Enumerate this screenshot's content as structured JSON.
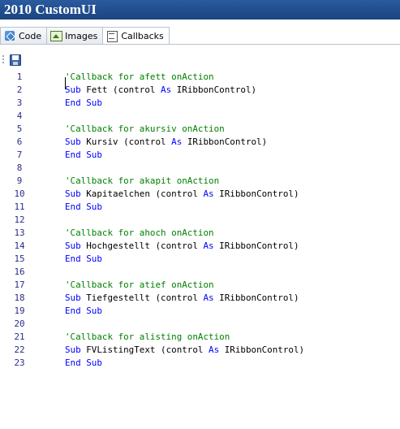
{
  "window": {
    "title": "2010 CustomUI"
  },
  "tabs": [
    {
      "label": "Code",
      "icon": "code-icon"
    },
    {
      "label": "Images",
      "icon": "images-icon"
    },
    {
      "label": "Callbacks",
      "icon": "callbacks-icon",
      "active": true
    }
  ],
  "toolbar": {
    "save_icon": "save-icon"
  },
  "colors": {
    "keyword": "#0000ff",
    "comment": "#008000",
    "line_number": "#2b2b8a",
    "title_bar": "#1f4c8c"
  },
  "editor": {
    "lines": [
      {
        "num": "1",
        "parts": [
          [
            "cm",
            "'Callback for afett onAction"
          ]
        ]
      },
      {
        "num": "2",
        "parts": [
          [
            "kw",
            "Sub"
          ],
          [
            "tx",
            " Fett (control "
          ],
          [
            "kw",
            "As"
          ],
          [
            "tx",
            " IRibbonControl)"
          ]
        ]
      },
      {
        "num": "3",
        "parts": [
          [
            "kw",
            "End Sub"
          ]
        ]
      },
      {
        "num": "4",
        "parts": []
      },
      {
        "num": "5",
        "parts": [
          [
            "cm",
            "'Callback for akursiv onAction"
          ]
        ]
      },
      {
        "num": "6",
        "parts": [
          [
            "kw",
            "Sub"
          ],
          [
            "tx",
            " Kursiv (control "
          ],
          [
            "kw",
            "As"
          ],
          [
            "tx",
            " IRibbonControl)"
          ]
        ]
      },
      {
        "num": "7",
        "parts": [
          [
            "kw",
            "End Sub"
          ]
        ]
      },
      {
        "num": "8",
        "parts": []
      },
      {
        "num": "9",
        "parts": [
          [
            "cm",
            "'Callback for akapit onAction"
          ]
        ]
      },
      {
        "num": "10",
        "parts": [
          [
            "kw",
            "Sub"
          ],
          [
            "tx",
            " Kapitaelchen (control "
          ],
          [
            "kw",
            "As"
          ],
          [
            "tx",
            " IRibbonControl)"
          ]
        ]
      },
      {
        "num": "11",
        "parts": [
          [
            "kw",
            "End Sub"
          ]
        ]
      },
      {
        "num": "12",
        "parts": []
      },
      {
        "num": "13",
        "parts": [
          [
            "cm",
            "'Callback for ahoch onAction"
          ]
        ]
      },
      {
        "num": "14",
        "parts": [
          [
            "kw",
            "Sub"
          ],
          [
            "tx",
            " Hochgestellt (control "
          ],
          [
            "kw",
            "As"
          ],
          [
            "tx",
            " IRibbonControl)"
          ]
        ]
      },
      {
        "num": "15",
        "parts": [
          [
            "kw",
            "End Sub"
          ]
        ]
      },
      {
        "num": "16",
        "parts": []
      },
      {
        "num": "17",
        "parts": [
          [
            "cm",
            "'Callback for atief onAction"
          ]
        ]
      },
      {
        "num": "18",
        "parts": [
          [
            "kw",
            "Sub"
          ],
          [
            "tx",
            " Tiefgestellt (control "
          ],
          [
            "kw",
            "As"
          ],
          [
            "tx",
            " IRibbonControl)"
          ]
        ]
      },
      {
        "num": "19",
        "parts": [
          [
            "kw",
            "End Sub"
          ]
        ]
      },
      {
        "num": "20",
        "parts": []
      },
      {
        "num": "21",
        "parts": [
          [
            "cm",
            "'Callback for alisting onAction"
          ]
        ]
      },
      {
        "num": "22",
        "parts": [
          [
            "kw",
            "Sub"
          ],
          [
            "tx",
            " FVListingText (control "
          ],
          [
            "kw",
            "As"
          ],
          [
            "tx",
            " IRibbonControl)"
          ]
        ]
      },
      {
        "num": "23",
        "parts": [
          [
            "kw",
            "End Sub"
          ]
        ]
      }
    ]
  }
}
